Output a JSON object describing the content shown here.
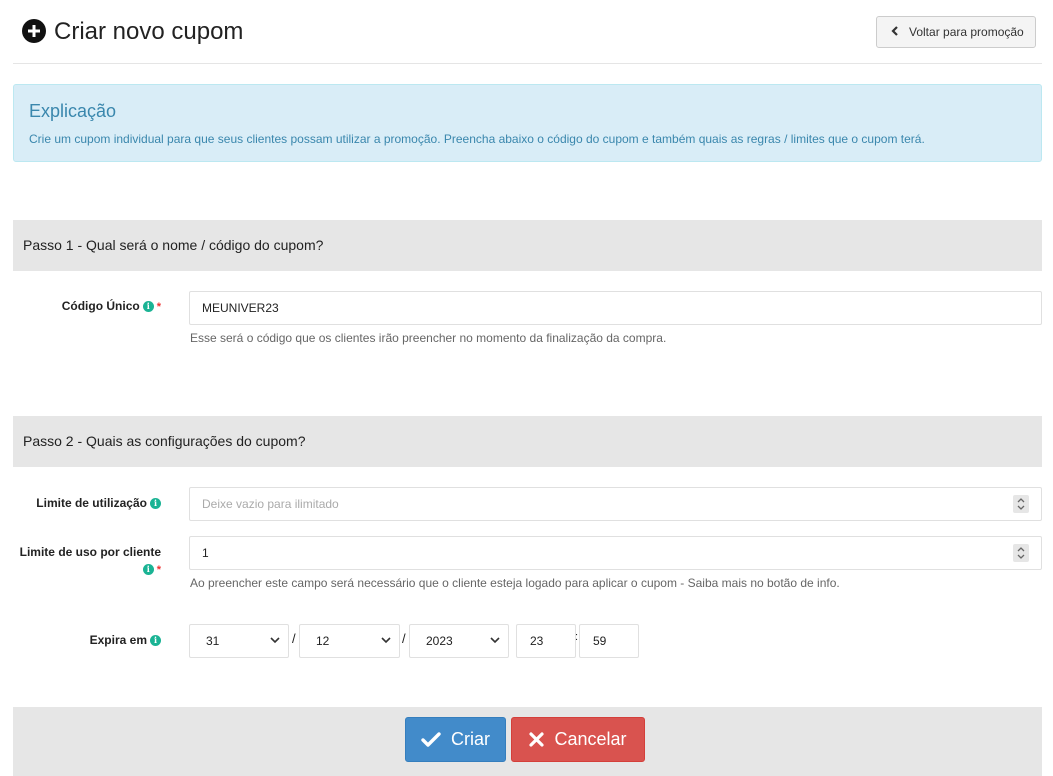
{
  "header": {
    "title": "Criar novo cupom",
    "title_icon": "plus-circle-icon",
    "back_button": "Voltar para promoção"
  },
  "alert": {
    "title": "Explicação",
    "text": "Crie um cupom individual para que seus clientes possam utilizar a promoção. Preencha abaixo o código do cupom e também quais as regras / limites que o cupom terá."
  },
  "step1": {
    "heading": "Passo 1 - Qual será o nome / código do cupom?",
    "code_label": "Código Único",
    "code_value": "MEUNIVER23",
    "code_help": "Esse será o código que os clientes irão preencher no momento da finalização da compra."
  },
  "step2": {
    "heading": "Passo 2 - Quais as configurações do cupom?",
    "usage_limit_label": "Limite de utilização",
    "usage_limit_placeholder": "Deixe vazio para ilimitado",
    "per_client_label": "Limite de uso por cliente",
    "per_client_value": "1",
    "per_client_help": "Ao preencher este campo será necessário que o cliente esteja logado para aplicar o cupom - Saiba mais no botão de info.",
    "expires_label": "Expira em",
    "expires": {
      "day": "31",
      "month": "12",
      "year": "2023",
      "hour": "23",
      "minute": "59",
      "date_sep": "/",
      "time_sep": ":"
    }
  },
  "footer": {
    "create": "Criar",
    "cancel": "Cancelar"
  },
  "colors": {
    "primary": "#428bca",
    "danger": "#d9534f",
    "info_icon": "#1ab394",
    "alert_bg": "#d9edf7",
    "alert_text": "#3a87ad"
  }
}
